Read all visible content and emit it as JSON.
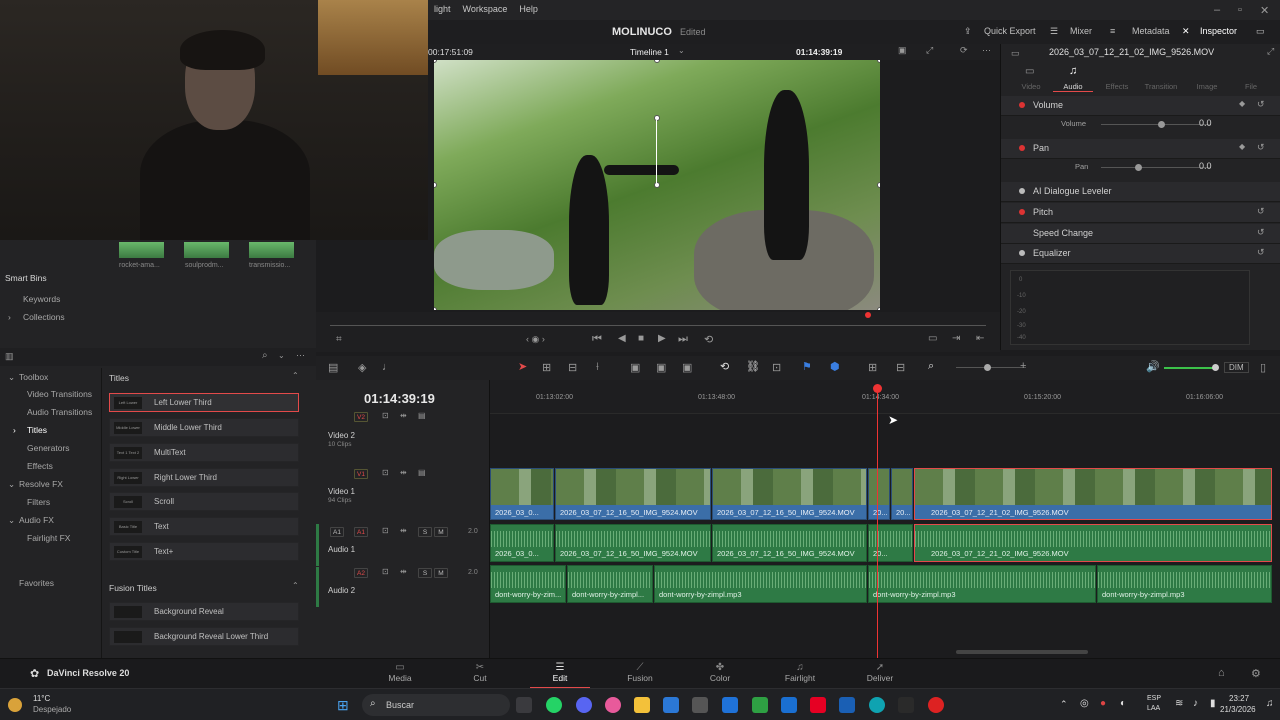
{
  "menu": {
    "items": [
      "light",
      "Workspace",
      "Help"
    ]
  },
  "titlebar": {
    "project": "MOLINUCO",
    "status": "Edited",
    "quick_export": "Quick Export",
    "mixer": "Mixer",
    "metadata": "Metadata",
    "inspector": "Inspector"
  },
  "viewer": {
    "source_tc": "00:17:51:09",
    "timeline_name": "Timeline 1",
    "record_tc": "01:14:39:19"
  },
  "inspector": {
    "clip_name": "2026_03_07_12_21_02_IMG_9526.MOV",
    "tabs": [
      "Video",
      "Audio",
      "Effects",
      "Transition",
      "Image",
      "File"
    ],
    "active_tab": "Audio",
    "sections": {
      "volume": "Volume",
      "volume_label": "Volume",
      "volume_value": "0.0",
      "pan": "Pan",
      "pan_label": "Pan",
      "pan_value": "0.0",
      "dialogue": "AI Dialogue Leveler",
      "pitch": "Pitch",
      "speed": "Speed Change",
      "eq": "Equalizer"
    },
    "eq_db": [
      "0",
      "-10",
      "-20",
      "-30",
      "-40"
    ]
  },
  "media": {
    "thumbs": [
      "rocket-ama...",
      "soulprodm...",
      "transmissio..."
    ]
  },
  "bins": {
    "header": "Smart Bins",
    "items": [
      "Keywords",
      "Collections"
    ]
  },
  "toolbox": {
    "items": [
      "Toolbox",
      "Video Transitions",
      "Audio Transitions",
      "Titles",
      "Generators",
      "Effects",
      "Resolve FX",
      "Filters",
      "Audio FX",
      "Fairlight FX"
    ],
    "favorites": "Favorites"
  },
  "titles": {
    "header": "Titles",
    "items": [
      "Left Lower Third",
      "Middle Lower Third",
      "MultiText",
      "Right Lower Third",
      "Scroll",
      "Text",
      "Text+"
    ],
    "thumb_labels": [
      "Left Lower",
      "Middle Lower",
      "Text 1 Text 2",
      "Right Lower",
      "Scroll",
      "Basic Title",
      "Custom Title"
    ],
    "fusion_header": "Fusion Titles",
    "fusion_items": [
      "Background Reveal",
      "Background Reveal Lower Third"
    ]
  },
  "timeline": {
    "timecode": "01:14:39:19",
    "ruler": [
      "01:13:02:00",
      "01:13:48:00",
      "01:14:34:00",
      "01:15:20:00",
      "01:16:06:00"
    ],
    "tracks": {
      "v2": {
        "id": "V2",
        "name": "Video 2",
        "clips": "10 Clips"
      },
      "v1": {
        "id": "V1",
        "name": "Video 1",
        "clips": "94 Clips"
      },
      "a1": {
        "id": "A1",
        "name": "Audio 1",
        "level": "2.0"
      },
      "a2": {
        "id": "A2",
        "name": "Audio 2",
        "level": "2.0"
      }
    },
    "video_clips": [
      "2026_03_0...",
      "2026_03_07_12_16_50_IMG_9524.MOV",
      "2026_03_07_12_16_50_IMG_9524.MOV",
      "20...",
      "20...",
      "2026_03_07_12_21_02_IMG_9526.MOV"
    ],
    "audio1_clips": [
      "2026_03_0...",
      "2026_03_07_12_16_50_IMG_9524.MOV",
      "2026_03_07_12_16_50_IMG_9524.MOV",
      "20...",
      "2026_03_07_12_21_02_IMG_9526.MOV"
    ],
    "audio2_clips": [
      "dont-worry-by-zim...",
      "dont-worry-by-zimpl...",
      "dont-worry-by-zimpl.mp3",
      "dont-worry-by-zimpl.mp3",
      "dont-worry-by-zimpl.mp3"
    ],
    "dim": "DIM"
  },
  "pages": {
    "app": "DaVinci Resolve 20",
    "items": [
      "Media",
      "Cut",
      "Edit",
      "Fusion",
      "Color",
      "Fairlight",
      "Deliver"
    ],
    "active": "Edit"
  },
  "taskbar": {
    "temp": "11°C",
    "weather": "Despejado",
    "search": "Buscar",
    "lang": "ESP",
    "region": "LAA",
    "time": "23:27",
    "date": "21/3/2026"
  },
  "colors": {
    "accent": "#e34a4a",
    "video_clip": "#3b6ea8",
    "audio_clip": "#2e7a45",
    "playhead": "#e33333"
  }
}
